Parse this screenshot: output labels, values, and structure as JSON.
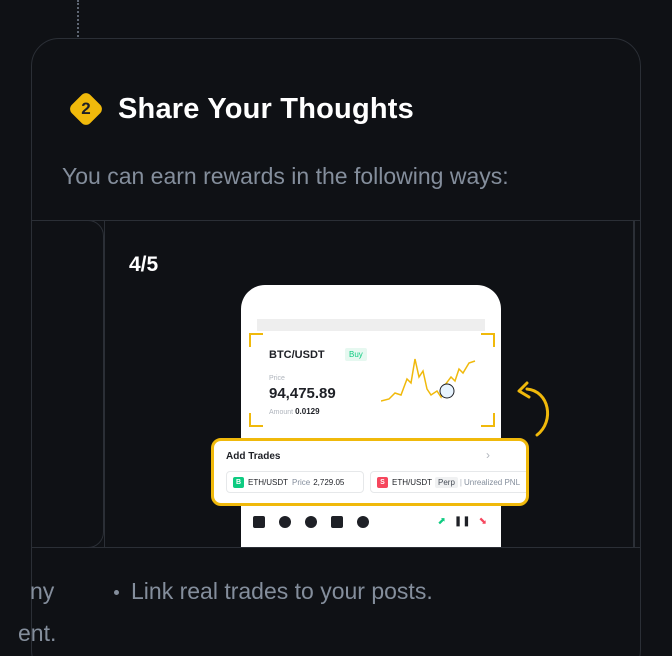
{
  "step": {
    "number": "2",
    "title": "Share Your Thoughts"
  },
  "subtitle": "You can earn rewards in the following ways:",
  "carousel": {
    "counter": "4/5"
  },
  "mockup": {
    "pair": "BTC/USDT",
    "buy_tag": "Buy",
    "price_label": "Price",
    "price_value": "94,475.89",
    "amount_label": "Amount",
    "amount_value": "0.0129",
    "add_trades_title": "Add Trades",
    "chevron": "›",
    "trade1": {
      "side": "B",
      "pair": "ETH/USDT",
      "price_label": "Price",
      "price_value": "2,729.05"
    },
    "trade2": {
      "side": "S",
      "pair": "ETH/USDT",
      "perp": "Perp",
      "sep": "|",
      "pnl_label": "Unrealized PNL"
    }
  },
  "bottom": {
    "left_fragment_1": "ny",
    "left_fragment_2": "ent.",
    "bullet": "Link real trades to your posts."
  },
  "colors": {
    "accent": "#f0b90b",
    "background": "#0f1115",
    "muted_text": "#848e9c"
  }
}
